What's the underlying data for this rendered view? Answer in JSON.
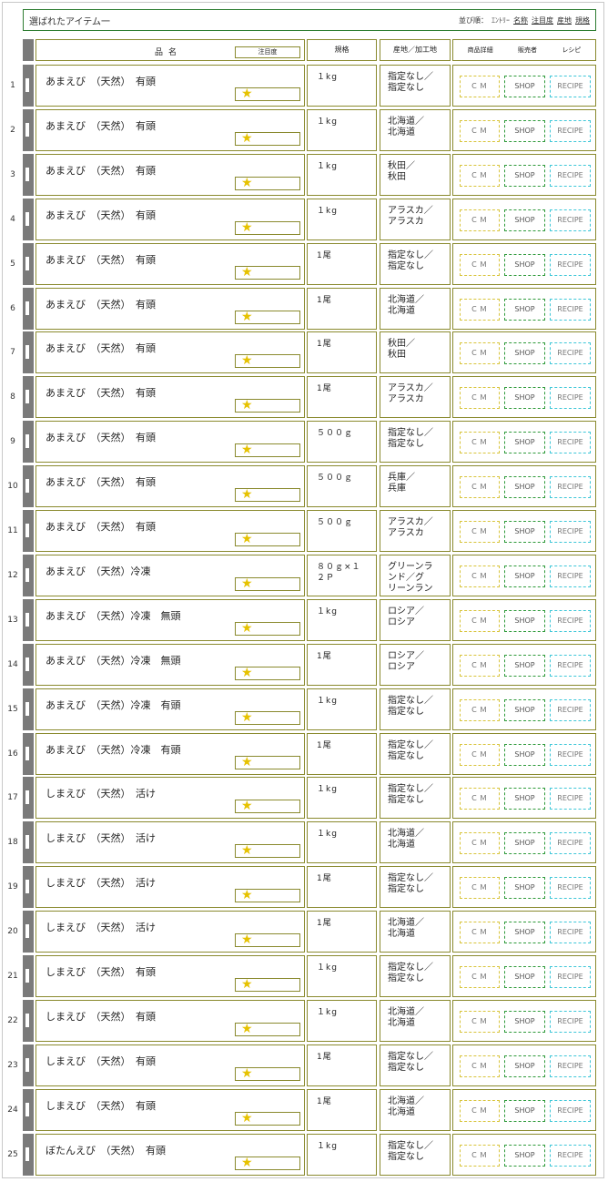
{
  "header": {
    "title": "選ばれたアイテム一",
    "sort_label": "並び順：",
    "sort_entry": "ｴﾝﾄﾘｰ",
    "sort_options": [
      "名称",
      "注目度",
      "産地",
      "規格"
    ]
  },
  "columns": {
    "name": "品名",
    "attention": "注目度",
    "spec": "規格",
    "origin": "産地／加工地",
    "detail": "商品詳細",
    "seller": "販売者",
    "recipe": "レシピ"
  },
  "buttons": {
    "cm": "ＣＭ",
    "shop": "SHOP",
    "recipe": "RECIPE"
  },
  "star_symbol": "★",
  "rows": [
    {
      "num": "1",
      "name": "あまえび　（天然）　有頭",
      "spec": "１kg",
      "origin": "指定なし／\n指定なし"
    },
    {
      "num": "2",
      "name": "あまえび　（天然）　有頭",
      "spec": "１kg",
      "origin": "北海道／\n北海道"
    },
    {
      "num": "3",
      "name": "あまえび　（天然）　有頭",
      "spec": "１kg",
      "origin": "秋田／\n秋田"
    },
    {
      "num": "4",
      "name": "あまえび　（天然）　有頭",
      "spec": "１kg",
      "origin": "アラスカ／\nアラスカ"
    },
    {
      "num": "5",
      "name": "あまえび　（天然）　有頭",
      "spec": "1尾",
      "origin": "指定なし／\n指定なし"
    },
    {
      "num": "6",
      "name": "あまえび　（天然）　有頭",
      "spec": "1尾",
      "origin": "北海道／\n北海道"
    },
    {
      "num": "7",
      "name": "あまえび　（天然）　有頭",
      "spec": "1尾",
      "origin": "秋田／\n秋田"
    },
    {
      "num": "8",
      "name": "あまえび　（天然）　有頭",
      "spec": "1尾",
      "origin": "アラスカ／\nアラスカ"
    },
    {
      "num": "9",
      "name": "あまえび　（天然）　有頭",
      "spec": "５００ｇ",
      "origin": "指定なし／\n指定なし"
    },
    {
      "num": "10",
      "name": "あまえび　（天然）　有頭",
      "spec": "５００ｇ",
      "origin": "兵庫／\n兵庫"
    },
    {
      "num": "11",
      "name": "あまえび　（天然）　有頭",
      "spec": "５００ｇ",
      "origin": "アラスカ／\nアラスカ"
    },
    {
      "num": "12",
      "name": "あまえび　（天然）冷凍",
      "spec": "８０ｇ×１\n２Ｐ",
      "origin": "グリーンラ\nンド／グ\nリーンラン"
    },
    {
      "num": "13",
      "name": "あまえび　（天然）冷凍　無頭",
      "spec": "１kg",
      "origin": "ロシア／\nロシア"
    },
    {
      "num": "14",
      "name": "あまえび　（天然）冷凍　無頭",
      "spec": "1尾",
      "origin": "ロシア／\nロシア"
    },
    {
      "num": "15",
      "name": "あまえび　（天然）冷凍　有頭",
      "spec": "１kg",
      "origin": "指定なし／\n指定なし"
    },
    {
      "num": "16",
      "name": "あまえび　（天然）冷凍　有頭",
      "spec": "1尾",
      "origin": "指定なし／\n指定なし"
    },
    {
      "num": "17",
      "name": "しまえび　（天然）　活け",
      "spec": "１kg",
      "origin": "指定なし／\n指定なし"
    },
    {
      "num": "18",
      "name": "しまえび　（天然）　活け",
      "spec": "１kg",
      "origin": "北海道／\n北海道"
    },
    {
      "num": "19",
      "name": "しまえび　（天然）　活け",
      "spec": "1尾",
      "origin": "指定なし／\n指定なし"
    },
    {
      "num": "20",
      "name": "しまえび　（天然）　活け",
      "spec": "1尾",
      "origin": "北海道／\n北海道"
    },
    {
      "num": "21",
      "name": "しまえび　（天然）　有頭",
      "spec": "１kg",
      "origin": "指定なし／\n指定なし"
    },
    {
      "num": "22",
      "name": "しまえび　（天然）　有頭",
      "spec": "１kg",
      "origin": "北海道／\n北海道"
    },
    {
      "num": "23",
      "name": "しまえび　（天然）　有頭",
      "spec": "1尾",
      "origin": "指定なし／\n指定なし"
    },
    {
      "num": "24",
      "name": "しまえび　（天然）　有頭",
      "spec": "1尾",
      "origin": "北海道／\n北海道"
    },
    {
      "num": "25",
      "name": "ぼたんえび　（天然）　有頭",
      "spec": "１kg",
      "origin": "指定なし／\n指定なし"
    }
  ],
  "colors": {
    "header_border": "#2e7d32",
    "cell_border": "#8a8a2e",
    "stripe": "#7a7a7a",
    "star": "#e6c200",
    "cm_border": "#d8c43a",
    "shop_border": "#2e9a3a",
    "recipe_border": "#3ec7d8"
  }
}
